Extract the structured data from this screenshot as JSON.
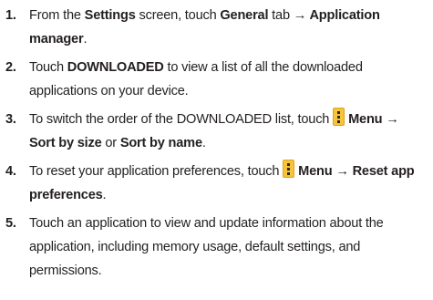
{
  "menu_icon": "menu-icon",
  "accent_color": "#f6c33b",
  "steps": [
    {
      "num": "1.",
      "t1": "From the ",
      "b1": "Settings",
      "t2": " screen, touch ",
      "b2": "General",
      "t3": " tab ",
      "b3": "→ Application manager",
      "t4": "."
    },
    {
      "num": "2.",
      "t1": "Touch ",
      "b1": "DOWNLOADED",
      "t2": " to view a list of all the downloaded applications on your device."
    },
    {
      "num": "3.",
      "t1": "To switch the order of the DOWNLOADED list, touch ",
      "b1": "Menu → Sort by size",
      "t2": " or ",
      "b2": "Sort by name",
      "t3": "."
    },
    {
      "num": "4.",
      "t1": "To reset your application preferences, touch ",
      "b1": "Menu → Reset app preferences",
      "t2": "."
    },
    {
      "num": "5.",
      "t1": "Touch an application to view and update information about the application, including memory usage, default settings, and permissions."
    }
  ]
}
